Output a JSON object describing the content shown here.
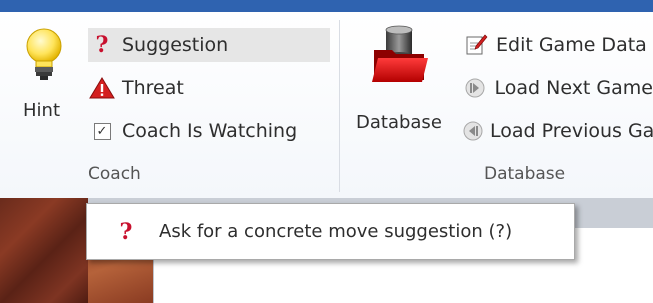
{
  "colors": {
    "accent": "#2f63b0",
    "question": "#c8102e",
    "threat": "#d42020",
    "database": "#cc1111"
  },
  "coach": {
    "hint_label": "Hint",
    "suggestion_label": "Suggestion",
    "threat_label": "Threat",
    "coach_watching_label": "Coach Is Watching",
    "coach_watching_checked": true,
    "group_label": "Coach"
  },
  "database": {
    "database_label": "Database",
    "edit_label": "Edit Game Data",
    "next_label": "Load Next Game",
    "prev_label": "Load Previous Game",
    "group_label": "Database"
  },
  "tooltip": {
    "text": "Ask for a concrete move suggestion (?)"
  },
  "icons": {
    "hint": "lightbulb-icon",
    "suggestion": "question-mark-icon",
    "threat": "warning-triangle-icon",
    "checkbox": "checkbox-icon",
    "database": "database-folder-icon",
    "edit": "edit-pencil-icon",
    "next": "next-arrow-icon",
    "prev": "previous-arrow-icon"
  }
}
